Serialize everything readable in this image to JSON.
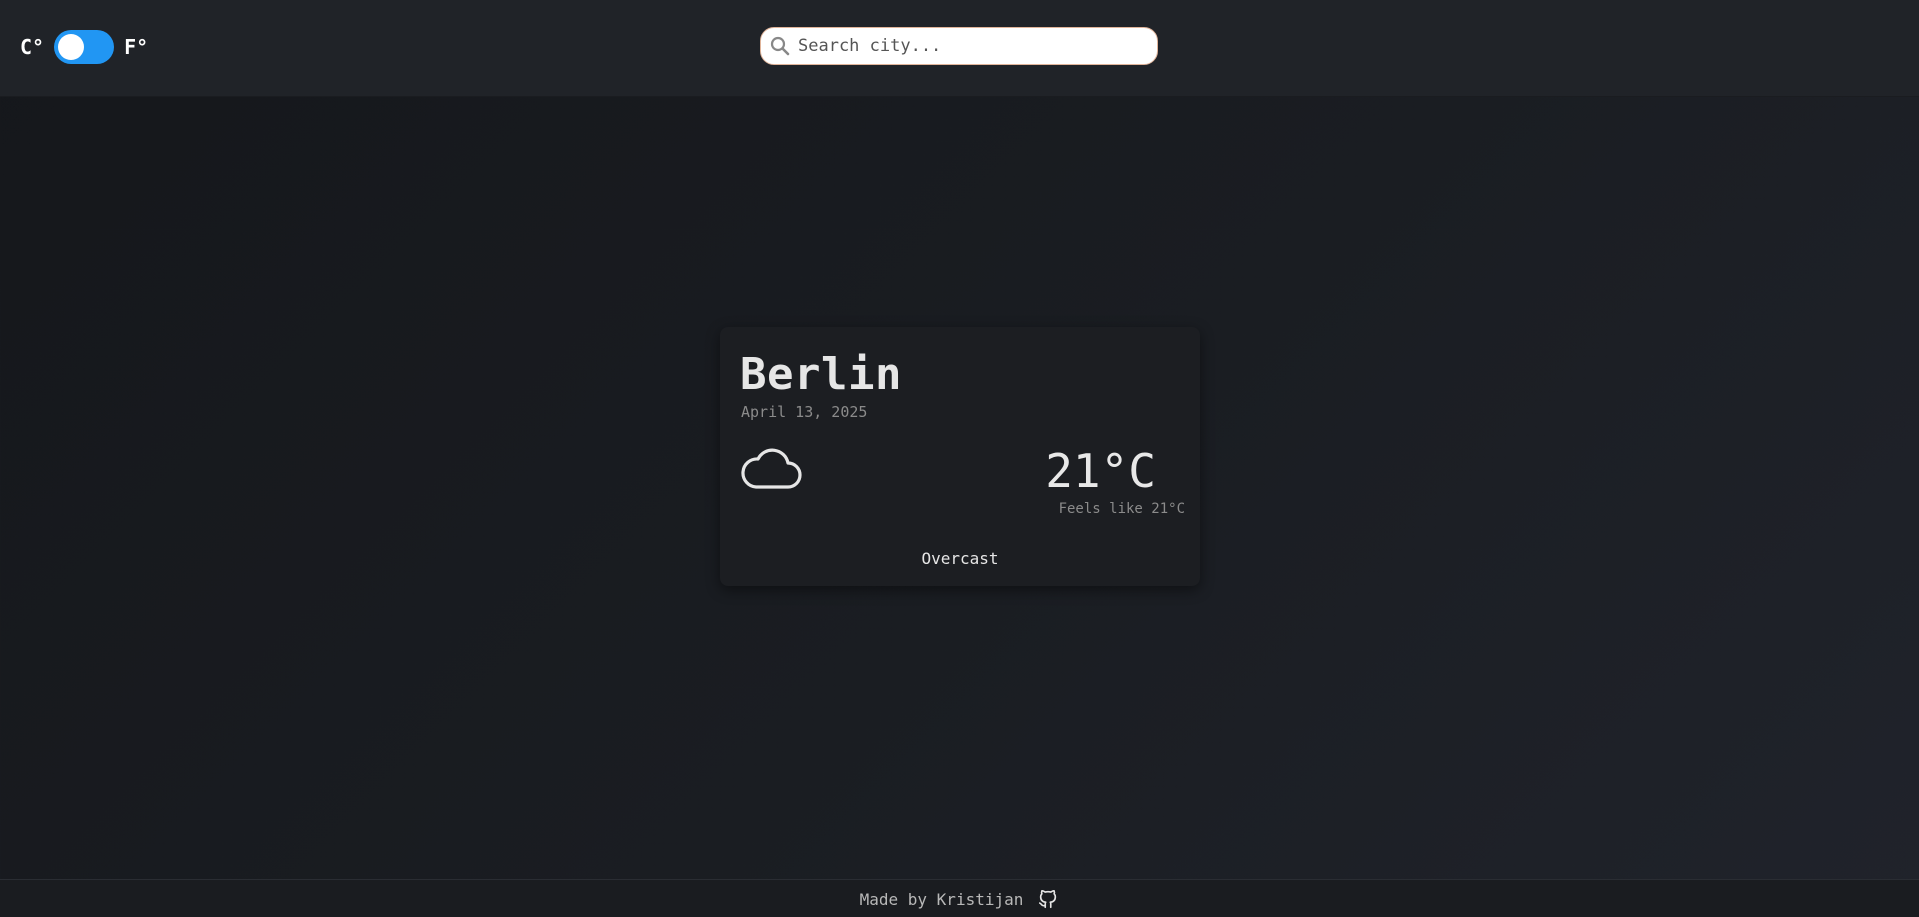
{
  "header": {
    "unit_toggle": {
      "celsius_label": "C°",
      "fahrenheit_label": "F°",
      "active_color": "#2196f3"
    },
    "search": {
      "placeholder": "Search city...",
      "value": ""
    }
  },
  "weather_card": {
    "city": "Berlin",
    "date": "April 13, 2025",
    "icon": "cloud-icon",
    "temperature": "21°C",
    "feels_like": "Feels like 21°C",
    "condition": "Overcast"
  },
  "footer": {
    "text": "Made by Kristijan",
    "icon": "github-icon"
  }
}
